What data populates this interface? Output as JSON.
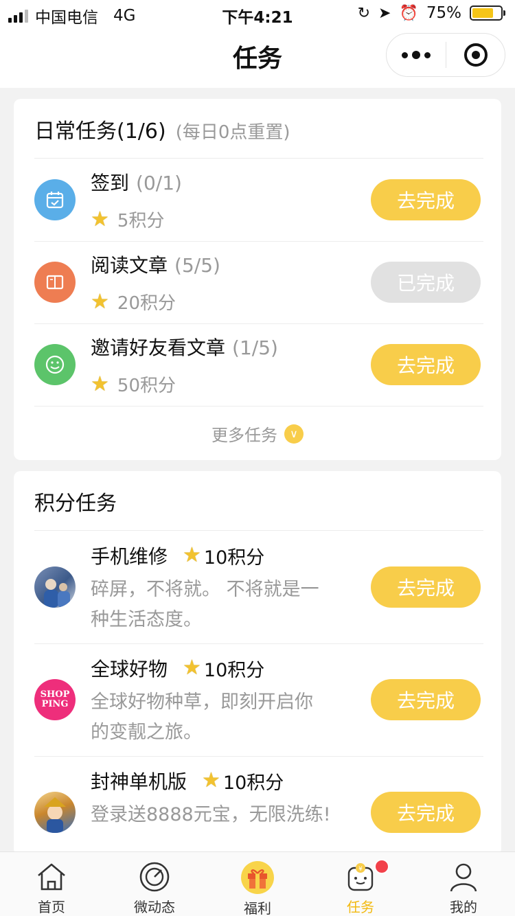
{
  "status_bar": {
    "carrier": "中国电信",
    "network": "4G",
    "time": "下午4:21",
    "battery": "75%",
    "battery_level": 0.75
  },
  "nav": {
    "title": "任务"
  },
  "daily": {
    "title": "日常任务(1/6)",
    "subtitle": "(每日0点重置)",
    "tasks": [
      {
        "name": "签到",
        "progress": "(0/1)",
        "points": "5积分",
        "button": "去完成",
        "icon": "calendar-icon",
        "icon_color": "#5aaee8"
      },
      {
        "name": "阅读文章",
        "progress": "(5/5)",
        "points": "20积分",
        "button": "已完成",
        "icon": "book-icon",
        "icon_color": "#ee7d52"
      },
      {
        "name": "邀请好友看文章",
        "progress": "(1/5)",
        "points": "50积分",
        "button": "去完成",
        "icon": "smile-icon",
        "icon_color": "#5cc46a"
      }
    ],
    "more": "更多任务"
  },
  "points_tasks": {
    "title": "积分任务",
    "items": [
      {
        "name": "手机维修",
        "points": "10积分",
        "desc": "碎屏，不将就。 不将就是一种生活态度。",
        "button": "去完成"
      },
      {
        "name": "全球好物",
        "points": "10积分",
        "desc": "全球好物种草，即刻开启你的变靓之旅。",
        "button": "去完成",
        "logo_line1": "SHOP",
        "logo_line2": "PING"
      },
      {
        "name": "封神单机版",
        "points": "10积分",
        "desc": "登录送8888元宝，无限洗练!",
        "button": "去完成"
      }
    ]
  },
  "tabbar": [
    {
      "label": "首页",
      "icon": "home-icon"
    },
    {
      "label": "微动态",
      "icon": "radar-icon"
    },
    {
      "label": "福利",
      "icon": "gift-icon"
    },
    {
      "label": "任务",
      "icon": "task-icon",
      "active": true
    },
    {
      "label": "我的",
      "icon": "user-icon"
    }
  ],
  "colors": {
    "accent": "#f8cd4a",
    "active_tab": "#f2b90f",
    "badge": "#f2414a"
  }
}
